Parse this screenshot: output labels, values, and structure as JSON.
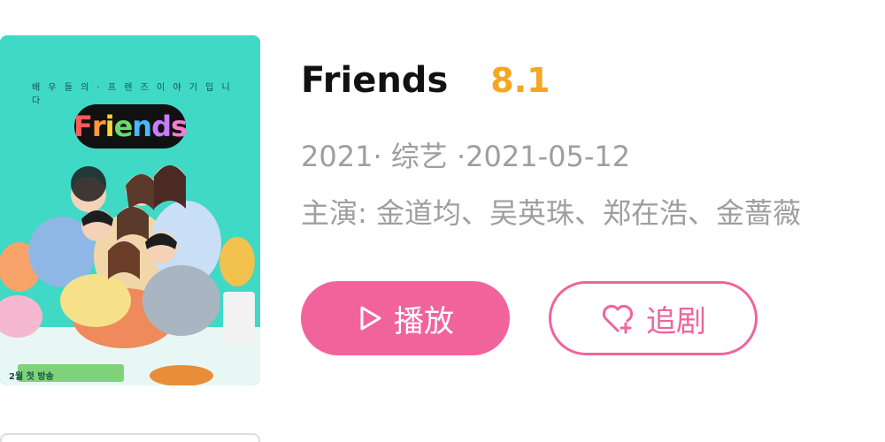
{
  "poster": {
    "logo_text": "Friends",
    "tagline": "배 우 들 의 · 프 렌 즈 이 야 기 입 니 다",
    "footer": "2월 첫 방송"
  },
  "show": {
    "title": "Friends",
    "rating": "8.1",
    "meta": "2021· 综艺 ·2021-05-12",
    "cast": "主演: 金道均、吴英珠、郑在浩、金蔷薇"
  },
  "actions": {
    "play_label": "播放",
    "follow_label": "追剧"
  },
  "colors": {
    "accent": "#f0649b",
    "rating": "#f5a623",
    "poster_bg": "#3fd9c6",
    "muted_text": "#9e9e9e"
  },
  "icons": {
    "play": "play-triangle-icon",
    "follow": "heart-plus-icon"
  }
}
